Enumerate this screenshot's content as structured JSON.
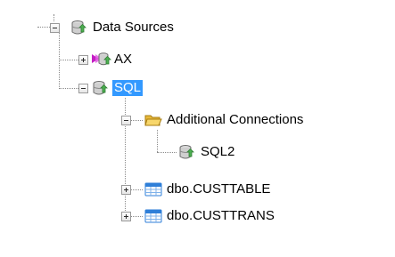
{
  "tree": {
    "root": {
      "label": "Data Sources",
      "icon": "database-icon",
      "expanded": true
    },
    "ax": {
      "label": "AX",
      "icon": "linked-database-icon",
      "expanded": false
    },
    "sql": {
      "label": "SQL",
      "icon": "database-icon",
      "expanded": true,
      "selected": true
    },
    "additional": {
      "label": "Additional Connections",
      "icon": "folder-icon",
      "expanded": true
    },
    "sql2": {
      "label": "SQL2",
      "icon": "database-icon"
    },
    "custtable": {
      "label": "dbo.CUSTTABLE",
      "icon": "table-icon",
      "expanded": false
    },
    "custtrans": {
      "label": "dbo.CUSTTRANS",
      "icon": "table-icon",
      "expanded": false
    }
  },
  "colors": {
    "selection": "#3399ff",
    "folder": "#f2c94c",
    "table": "#2f7fd8"
  }
}
